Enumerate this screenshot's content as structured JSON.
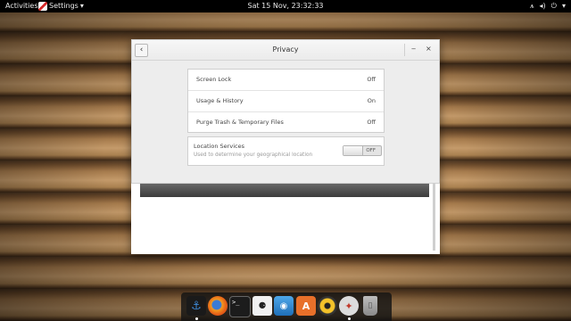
{
  "topbar": {
    "activities": "Activities",
    "app_menu": "Settings",
    "app_menu_arrow": "▾",
    "clock": "Sat 15 Nov, 23:32:33",
    "tray": {
      "wifi": "wifi-icon",
      "volume": "volume-icon",
      "power": "power-icon",
      "wifi_glyph": "⩚",
      "volume_glyph": "◂)",
      "power_glyph": "⏻",
      "arrow": "▾"
    }
  },
  "window": {
    "title": "Privacy",
    "back_glyph": "‹",
    "minimize_glyph": "‒",
    "close_glyph": "×",
    "rows": [
      {
        "label": "Screen Lock",
        "value": "Off"
      },
      {
        "label": "Usage & History",
        "value": "On"
      },
      {
        "label": "Purge Trash & Temporary Files",
        "value": "Off"
      }
    ],
    "location": {
      "label": "Location Services",
      "description": "Used to determine your geographical location",
      "switch_state": "OFF"
    }
  },
  "dock": {
    "items": [
      {
        "name": "anchor-icon",
        "glyph": "⚓"
      },
      {
        "name": "firefox-icon",
        "glyph": ""
      },
      {
        "name": "terminal-icon",
        "glyph": ">_"
      },
      {
        "name": "notes-icon",
        "glyph": "⚈"
      },
      {
        "name": "photos-icon",
        "glyph": "◉"
      },
      {
        "name": "software-center-icon",
        "glyph": "A"
      },
      {
        "name": "music-icon",
        "glyph": ""
      },
      {
        "name": "settings-icon",
        "glyph": "✦"
      },
      {
        "name": "trash-icon",
        "glyph": "▯"
      }
    ]
  },
  "colors": {
    "topbar": "#000000",
    "dialog_bg": "#ededed",
    "list_bg": "#ffffff",
    "border": "#cfcfcf"
  }
}
